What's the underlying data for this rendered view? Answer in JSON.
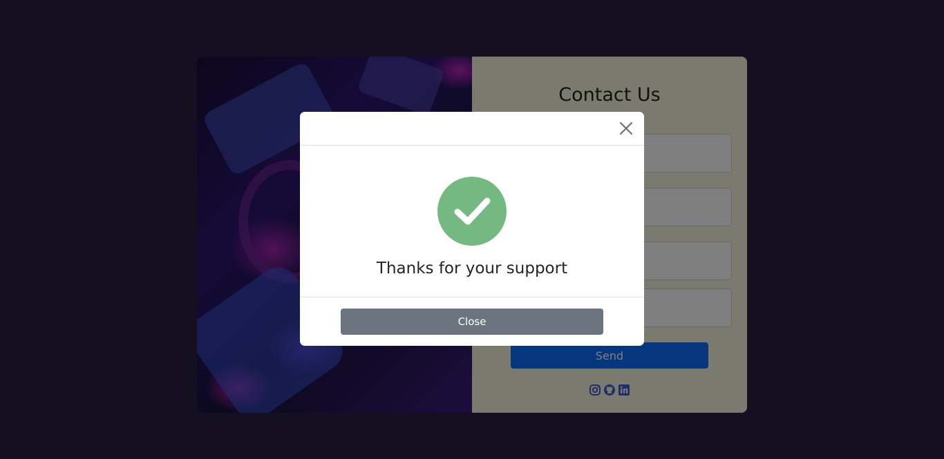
{
  "contact": {
    "title": "Contact Us",
    "send_label": "Send",
    "social_icons": [
      "instagram-icon",
      "github-icon",
      "linkedin-icon"
    ]
  },
  "modal": {
    "message": "Thanks for your support",
    "close_label": "Close",
    "success_color": "#75b982"
  },
  "colors": {
    "page_background": "#292044",
    "form_background": "#f5f5dd",
    "primary": "#0d6efd",
    "secondary": "#6c757d"
  }
}
